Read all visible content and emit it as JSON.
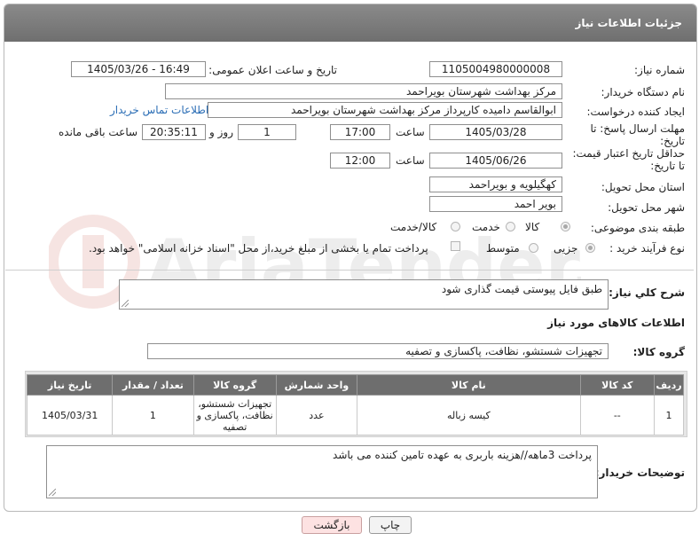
{
  "window": {
    "title": "جزئیات اطلاعات نیاز"
  },
  "fields": {
    "need_number": {
      "label": "شماره نیاز:",
      "value": "1105004980000008"
    },
    "announce_datetime": {
      "label": "تاریخ و ساعت اعلان عمومی:",
      "value": "1405/03/26 - 16:49"
    },
    "buyer_org": {
      "label": "نام دستگاه خریدار:",
      "value": "مرکز بهداشت شهرستان بویراحمد"
    },
    "requester": {
      "label": "ایجاد کننده درخواست:",
      "value": "ابوالقاسم دامیده کارپرداز مرکز بهداشت شهرستان بویراحمد",
      "link": "اطلاعات تماس خریدار"
    },
    "reply_deadline": {
      "label": "مهلت ارسال پاسخ: تا تاریخ:",
      "date": "1405/03/28",
      "time_label": "ساعت",
      "time": "17:00",
      "days": "1",
      "days_label": "روز و",
      "remaining": "20:35:11",
      "remaining_label": "ساعت باقی مانده"
    },
    "price_validity": {
      "label": "حداقل تاریخ اعتبار قیمت: تا تاریخ:",
      "date": "1405/06/26",
      "time_label": "ساعت",
      "time": "12:00"
    },
    "province": {
      "label": "استان محل تحویل:",
      "value": "کهگیلویه و بویراحمد"
    },
    "city": {
      "label": "شهر محل تحویل:",
      "value": "بویر احمد"
    },
    "category": {
      "label": "طبقه بندی موضوعی:",
      "options": [
        "کالا",
        "خدمت",
        "کالا/خدمت"
      ],
      "selected": "کالا"
    },
    "purchase_type": {
      "label": "نوع فرآیند خرید :",
      "options": [
        "جزیی",
        "متوسط"
      ],
      "selected": "جزیی",
      "note": "پرداخت تمام یا بخشی از مبلغ خرید،از محل \"اسناد خزانه اسلامی\" خواهد بود."
    }
  },
  "description": {
    "label": "شرح کلي نیاز:",
    "value": "طبق فایل پیوستی قیمت گذاری شود"
  },
  "goods_section": {
    "title": "اطلاعات کالاهای مورد نیاز",
    "group_label": "گروه کالا:",
    "group_value": "تجهیزات شستشو، نظافت، پاکسازی و تصفیه"
  },
  "table": {
    "headers": [
      "ردیف",
      "کد کالا",
      "نام کالا",
      "واحد شمارش",
      "گروه کالا",
      "تعداد / مقدار",
      "تاریخ نیاز"
    ],
    "rows": [
      {
        "row": "1",
        "code": "--",
        "name": "کیسه زباله",
        "unit": "عدد",
        "group": "تجهیزات شستشو، نظافت، پاکسازی و تصفیه",
        "qty": "1",
        "date": "1405/03/31"
      }
    ]
  },
  "buyer_notes": {
    "label": "توضیحات خریدار:",
    "value": "پرداخت 3ماهه//هزینه باربری به عهده تامین کننده می باشد"
  },
  "buttons": {
    "print": "چاپ",
    "back": "بازگشت"
  },
  "watermark": {
    "text": "AriaTender.net"
  },
  "colors": {
    "title_bar": "#7a7a7a",
    "link": "#2a6db5",
    "table_header": "#6e6e6e",
    "back_button": "#fde2e2"
  }
}
